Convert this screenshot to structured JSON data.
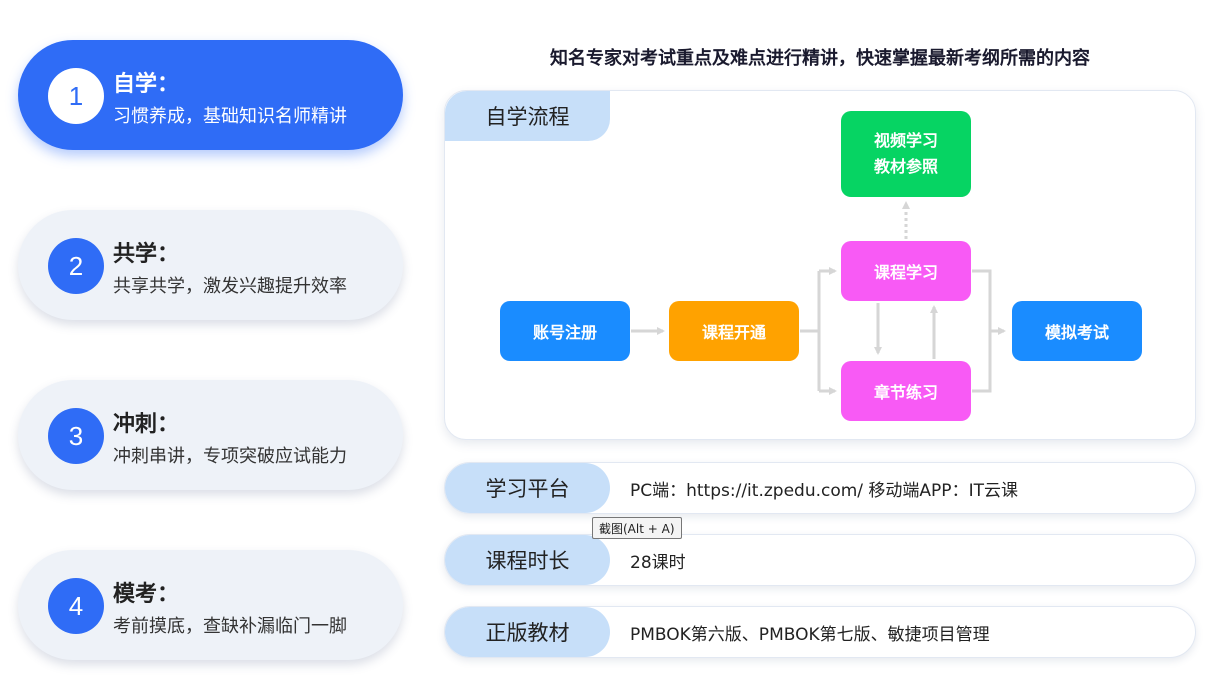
{
  "headline": "知名专家对考试重点及难点进行精讲，快速掌握最新考纲所需的内容",
  "steps": [
    {
      "num": "1",
      "title": "自学：",
      "desc": "习惯养成，基础知识名师精讲"
    },
    {
      "num": "2",
      "title": "共学：",
      "desc": "共享共学，激发兴趣提升效率"
    },
    {
      "num": "3",
      "title": "冲刺：",
      "desc": "冲刺串讲，专项突破应试能力"
    },
    {
      "num": "4",
      "title": "模考：",
      "desc": "考前摸底，查缺补漏临门一脚"
    }
  ],
  "flow": {
    "tag": "自学流程",
    "nodes": {
      "register": "账号注册",
      "open": "课程开通",
      "course": "课程学习",
      "chapter": "章节练习",
      "exam": "模拟考试",
      "video_line1": "视频学习",
      "video_line2": "教材参照"
    }
  },
  "info": [
    {
      "label": "学习平台",
      "value": "PC端：https://it.zpedu.com/ 移动端APP：IT云课"
    },
    {
      "label": "课程时长",
      "value": "28课时"
    },
    {
      "label": "正版教材",
      "value": "PMBOK第六版、PMBOK第七版、敏捷项目管理"
    }
  ],
  "tooltip": "截图(Alt + A)",
  "colors": {
    "primary": "#2f6cf6",
    "node_blue": "#1a8cff",
    "node_orange": "#ffa200",
    "node_magenta": "#f85af5",
    "node_green": "#06d463",
    "label_bg": "#c7dff9"
  }
}
